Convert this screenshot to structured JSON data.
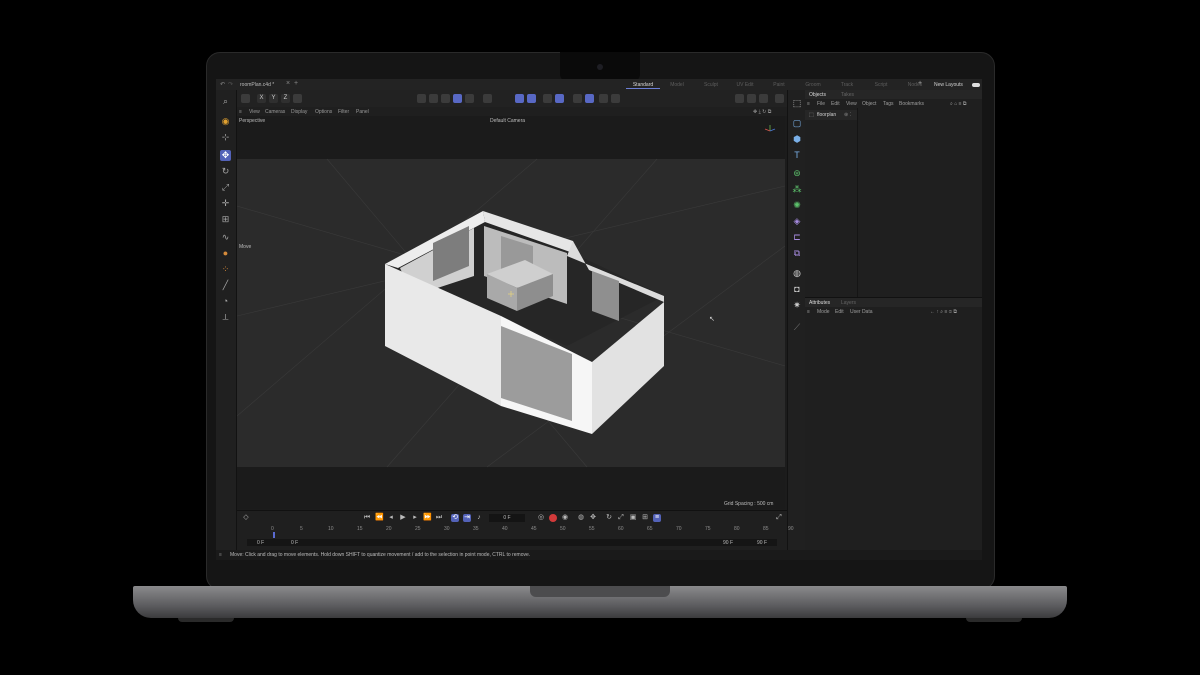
{
  "app": {
    "document_title": "roomPlan.c4d *",
    "layout_tabs": [
      "Standard",
      "Model",
      "Sculpt",
      "UV Edit",
      "Paint",
      "Groom",
      "Track",
      "Script",
      "Nodes"
    ],
    "active_layout": "Standard",
    "new_layouts_label": "New Layouts"
  },
  "coord_buttons": [
    "X",
    "Y",
    "Z"
  ],
  "viewport_menu": [
    "View",
    "Cameras",
    "Display",
    "Options",
    "Filter",
    "Panel"
  ],
  "viewport": {
    "name": "Perspective",
    "camera": "Default Camera",
    "tool_label": "Move",
    "grid_spacing": "Grid Spacing : 500 cm"
  },
  "objects_panel": {
    "tabs": [
      "Objects",
      "Takes"
    ],
    "menu": [
      "File",
      "Edit",
      "View",
      "Object",
      "Tags",
      "Bookmarks"
    ],
    "items": [
      "floorplan"
    ]
  },
  "attributes_panel": {
    "tabs": [
      "Attributes",
      "Layers"
    ],
    "menu": [
      "Mode",
      "Edit",
      "User Data"
    ]
  },
  "timeline": {
    "current_frame": "0 F",
    "ruler_ticks": [
      "0",
      "5",
      "10",
      "15",
      "20",
      "25",
      "30",
      "35",
      "40",
      "45",
      "50",
      "55",
      "60",
      "65",
      "70",
      "75",
      "80",
      "85",
      "90"
    ],
    "start_min": "0 F",
    "start": "0 F",
    "end": "90 F",
    "end_max": "90 F"
  },
  "status_bar": "Move: Click and drag to move elements. Hold down SHIFT to quantize movement / add to the selection in point mode, CTRL to remove.",
  "colors": {
    "accent": "#5362b8",
    "record": "#d23a3a",
    "viewport_bg": "#2b2b2b",
    "model": "#f2f2f2"
  }
}
